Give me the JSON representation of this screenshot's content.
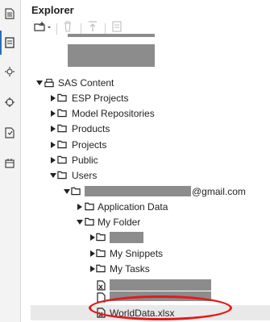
{
  "panel": {
    "title": "Explorer"
  },
  "rail": {
    "items": [
      {
        "icon": "document-icon"
      },
      {
        "icon": "explorer-icon",
        "active": true
      },
      {
        "icon": "gear-icon"
      },
      {
        "icon": "snippets-icon"
      },
      {
        "icon": "tasks-icon"
      },
      {
        "icon": "libraries-icon"
      }
    ]
  },
  "toolbar": {
    "new_icon": "new-item-icon",
    "delete_icon": "delete-icon",
    "upload_icon": "upload-icon",
    "properties_icon": "properties-icon"
  },
  "tree": {
    "sas_content": "SAS Content",
    "esp_projects": "ESP Projects",
    "model_repositories": "Model Repositories",
    "products": "Products",
    "projects": "Projects",
    "public": "Public",
    "users": "Users",
    "user_email_suffix": "@gmail.com",
    "application_data": "Application Data",
    "my_folder": "My Folder",
    "my_snippets": "My Snippets",
    "my_tasks": "My Tasks",
    "selected_file": "WorldData.xlsx"
  },
  "colors": {
    "annotation": "#e31a1a",
    "active_accent": "#2a6ebb",
    "redaction": "#8c8c8c"
  }
}
